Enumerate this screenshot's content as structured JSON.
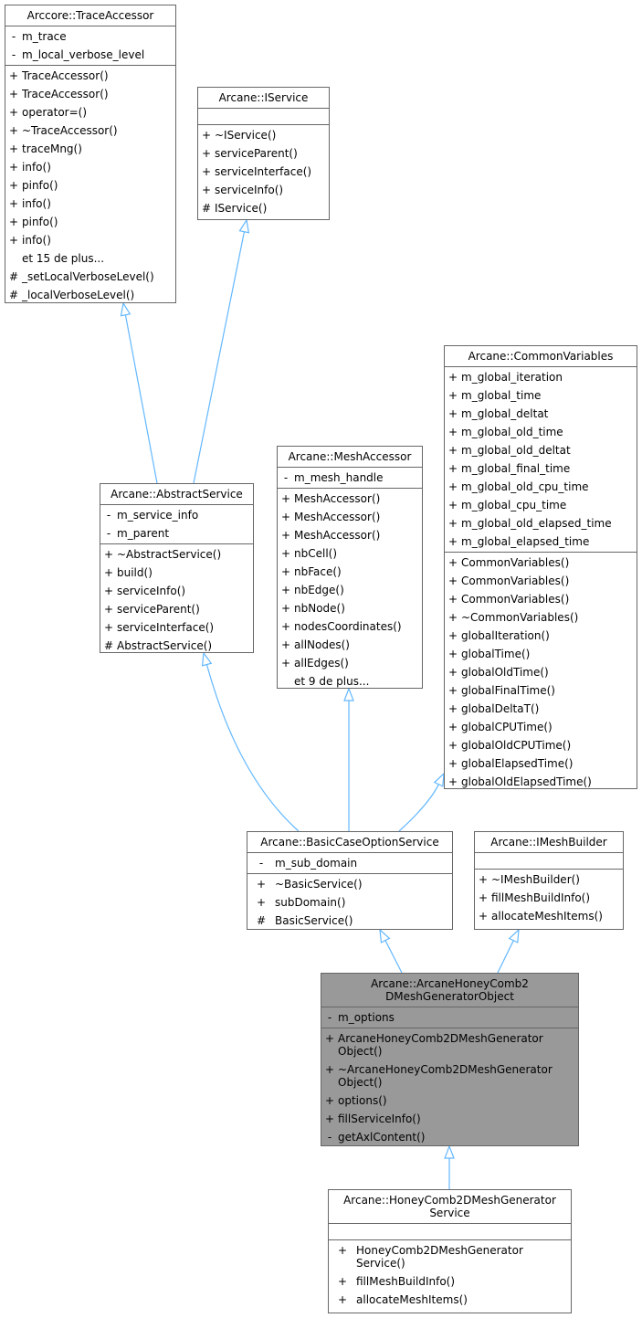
{
  "colors": {
    "edge": "#63b8ff",
    "border": "#666666",
    "focus_fill": "#999999"
  },
  "classes": [
    {
      "id": "trace",
      "title": "Arccore::TraceAccessor",
      "attributes": [
        [
          "-",
          "m_trace"
        ],
        [
          "-",
          "m_local_verbose_level"
        ]
      ],
      "methods": [
        [
          "+",
          "TraceAccessor()"
        ],
        [
          "+",
          "TraceAccessor()"
        ],
        [
          "+",
          "operator=()"
        ],
        [
          "+",
          "~TraceAccessor()"
        ],
        [
          "+",
          "traceMng()"
        ],
        [
          "+",
          "info()"
        ],
        [
          "+",
          "pinfo()"
        ],
        [
          "+",
          "info()"
        ],
        [
          "+",
          "pinfo()"
        ],
        [
          "+",
          "info()"
        ],
        [
          "",
          "et 15 de plus..."
        ],
        [
          "#",
          "_setLocalVerboseLevel()"
        ],
        [
          "#",
          "_localVerboseLevel()"
        ]
      ]
    },
    {
      "id": "iservice",
      "title": "Arcane::IService",
      "attributes": [],
      "methods": [
        [
          "+",
          "~IService()"
        ],
        [
          "+",
          "serviceParent()"
        ],
        [
          "+",
          "serviceInterface()"
        ],
        [
          "+",
          "serviceInfo()"
        ],
        [
          "#",
          "IService()"
        ]
      ]
    },
    {
      "id": "common",
      "title": "Arcane::CommonVariables",
      "attributes": [
        [
          "+",
          "m_global_iteration"
        ],
        [
          "+",
          "m_global_time"
        ],
        [
          "+",
          "m_global_deltat"
        ],
        [
          "+",
          "m_global_old_time"
        ],
        [
          "+",
          "m_global_old_deltat"
        ],
        [
          "+",
          "m_global_final_time"
        ],
        [
          "+",
          "m_global_old_cpu_time"
        ],
        [
          "+",
          "m_global_cpu_time"
        ],
        [
          "+",
          "m_global_old_elapsed_time"
        ],
        [
          "+",
          "m_global_elapsed_time"
        ]
      ],
      "methods": [
        [
          "+",
          "CommonVariables()"
        ],
        [
          "+",
          "CommonVariables()"
        ],
        [
          "+",
          "CommonVariables()"
        ],
        [
          "+",
          "~CommonVariables()"
        ],
        [
          "+",
          "globalIteration()"
        ],
        [
          "+",
          "globalTime()"
        ],
        [
          "+",
          "globalOldTime()"
        ],
        [
          "+",
          "globalFinalTime()"
        ],
        [
          "+",
          "globalDeltaT()"
        ],
        [
          "+",
          "globalCPUTime()"
        ],
        [
          "+",
          "globalOldCPUTime()"
        ],
        [
          "+",
          "globalElapsedTime()"
        ],
        [
          "+",
          "globalOldElapsedTime()"
        ]
      ]
    },
    {
      "id": "mesh",
      "title": "Arcane::MeshAccessor",
      "attributes": [
        [
          "-",
          "m_mesh_handle"
        ]
      ],
      "methods": [
        [
          "+",
          "MeshAccessor()"
        ],
        [
          "+",
          "MeshAccessor()"
        ],
        [
          "+",
          "MeshAccessor()"
        ],
        [
          "+",
          "nbCell()"
        ],
        [
          "+",
          "nbFace()"
        ],
        [
          "+",
          "nbEdge()"
        ],
        [
          "+",
          "nbNode()"
        ],
        [
          "+",
          "nodesCoordinates()"
        ],
        [
          "+",
          "allNodes()"
        ],
        [
          "+",
          "allEdges()"
        ],
        [
          "",
          "et 9 de plus..."
        ]
      ]
    },
    {
      "id": "abstract",
      "title": "Arcane::AbstractService",
      "attributes": [
        [
          "-",
          "m_service_info"
        ],
        [
          "-",
          "m_parent"
        ]
      ],
      "methods": [
        [
          "+",
          "~AbstractService()"
        ],
        [
          "+",
          "build()"
        ],
        [
          "+",
          "serviceInfo()"
        ],
        [
          "+",
          "serviceParent()"
        ],
        [
          "+",
          "serviceInterface()"
        ],
        [
          "#",
          "AbstractService()"
        ]
      ]
    },
    {
      "id": "basic",
      "title": "Arcane::BasicCaseOptionService",
      "attributes": [
        [
          "-",
          "m_sub_domain"
        ]
      ],
      "methods": [
        [
          "+",
          "~BasicService()"
        ],
        [
          "+",
          "subDomain()"
        ],
        [
          "#",
          "BasicService()"
        ]
      ]
    },
    {
      "id": "imesh",
      "title": "Arcane::IMeshBuilder",
      "attributes": [],
      "methods": [
        [
          "+",
          "~IMeshBuilder()"
        ],
        [
          "+",
          "fillMeshBuildInfo()"
        ],
        [
          "+",
          "allocateMeshItems()"
        ]
      ]
    },
    {
      "id": "object",
      "title": "Arcane::ArcaneHoneyComb2\nDMeshGeneratorObject",
      "focus": true,
      "attributes": [
        [
          "-",
          "m_options"
        ]
      ],
      "methods": [
        [
          "+",
          "ArcaneHoneyComb2DMeshGenerator\nObject()"
        ],
        [
          "+",
          "~ArcaneHoneyComb2DMeshGenerator\nObject()"
        ],
        [
          "+",
          "options()"
        ],
        [
          "+",
          "fillServiceInfo()"
        ],
        [
          "-",
          "getAxlContent()"
        ]
      ]
    },
    {
      "id": "service",
      "title": "Arcane::HoneyComb2DMeshGenerator\nService",
      "attributes": [],
      "methods": [
        [
          "+",
          "HoneyComb2DMeshGenerator\nService()"
        ],
        [
          "+",
          "fillMeshBuildInfo()"
        ],
        [
          "+",
          "allocateMeshItems()"
        ]
      ]
    }
  ],
  "inheritance": [
    [
      "abstract",
      "trace"
    ],
    [
      "abstract",
      "iservice"
    ],
    [
      "basic",
      "abstract"
    ],
    [
      "basic",
      "mesh"
    ],
    [
      "basic",
      "common"
    ],
    [
      "object",
      "basic"
    ],
    [
      "object",
      "imesh"
    ],
    [
      "service",
      "object"
    ]
  ]
}
